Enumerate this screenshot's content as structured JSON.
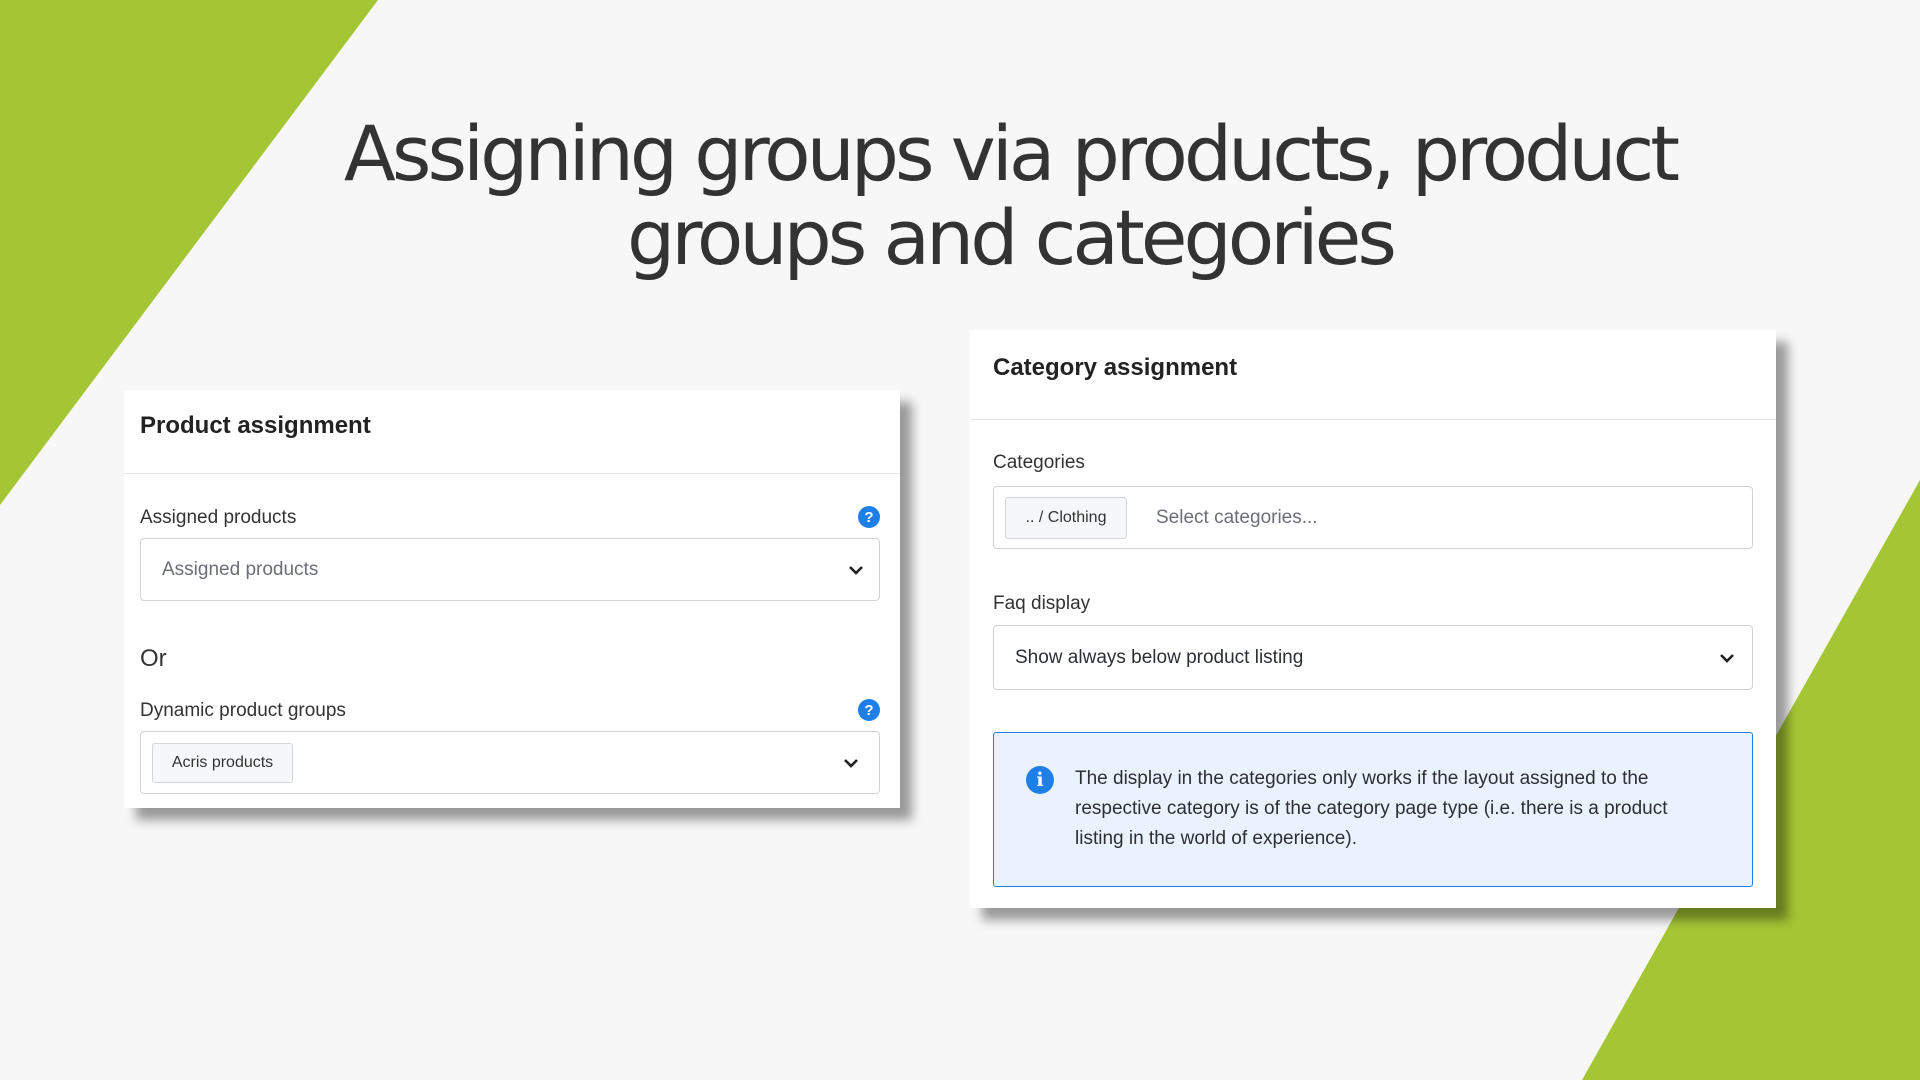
{
  "slide": {
    "title": "Assigning groups via products, product groups and categories",
    "accent_color": "#a5c634",
    "background_color": "#f7f7f7"
  },
  "product_assignment": {
    "header": "Product assignment",
    "assigned_products": {
      "label": "Assigned products",
      "placeholder": "Assigned products",
      "help_icon": "question-circle-icon"
    },
    "or_text": "Or",
    "dynamic_product_groups": {
      "label": "Dynamic product groups",
      "selected_chip": "Acris products",
      "help_icon": "question-circle-icon"
    }
  },
  "category_assignment": {
    "header": "Category assignment",
    "categories": {
      "label": "Categories",
      "selected_chip": ".. / Clothing",
      "placeholder": "Select categories..."
    },
    "faq_display": {
      "label": "Faq display",
      "value": "Show always below product listing"
    },
    "info": {
      "icon": "info-circle-icon",
      "line1": "The display in the categories only works if the layout assigned to the",
      "line2": "respective category is of the category page type (i.e. there is a product",
      "line3": "listing in the world of experience)."
    }
  }
}
